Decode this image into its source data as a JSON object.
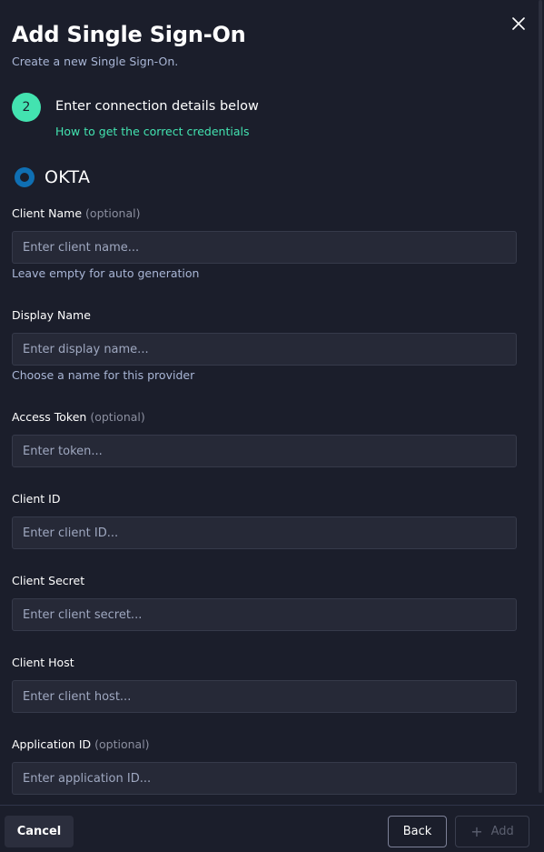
{
  "dialog": {
    "title": "Add Single Sign-On",
    "subtitle": "Create a new Single Sign-On."
  },
  "step": {
    "number": "2",
    "title": "Enter connection details below",
    "link": "How to get the correct credentials"
  },
  "provider": {
    "name": "OKTA",
    "logo_icon": "okta-logo-icon",
    "logo_color": "#0f6fb3"
  },
  "fields": {
    "client_name": {
      "label": "Client Name",
      "optional": "(optional)",
      "placeholder": "Enter client name...",
      "help": "Leave empty for auto generation"
    },
    "display_name": {
      "label": "Display Name",
      "placeholder": "Enter display name...",
      "help": "Choose a name for this provider"
    },
    "access_token": {
      "label": "Access Token",
      "optional": "(optional)",
      "placeholder": "Enter token..."
    },
    "client_id": {
      "label": "Client ID",
      "placeholder": "Enter client ID..."
    },
    "client_secret": {
      "label": "Client Secret",
      "placeholder": "Enter client secret..."
    },
    "client_host": {
      "label": "Client Host",
      "placeholder": "Enter client host..."
    },
    "application_id": {
      "label": "Application ID",
      "optional": "(optional)",
      "placeholder": "Enter application ID..."
    }
  },
  "footer": {
    "cancel_label": "Cancel",
    "back_label": "Back",
    "add_label": "Add"
  },
  "colors": {
    "background": "#1b1e2b",
    "accent": "#43e3b0",
    "input_bg": "#262937",
    "muted_text": "#a9b6d6"
  }
}
